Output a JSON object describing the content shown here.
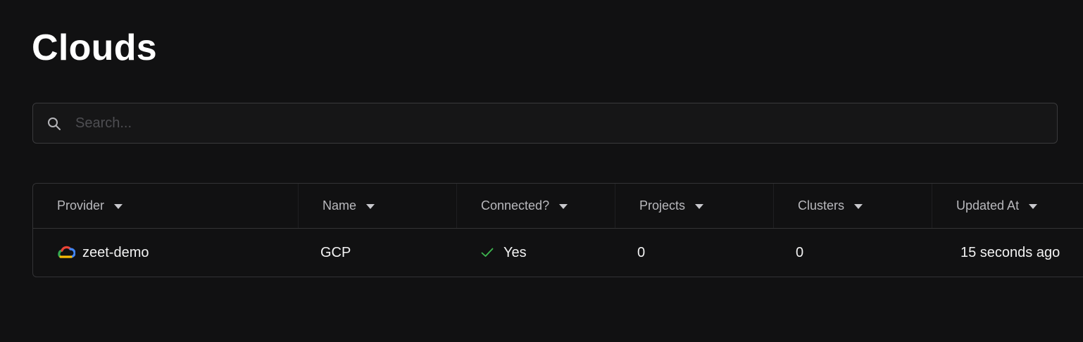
{
  "page": {
    "title": "Clouds"
  },
  "search": {
    "placeholder": "Search...",
    "value": "",
    "icon": "search-icon"
  },
  "table": {
    "columns": [
      {
        "label": "Provider",
        "icon": "caret-down-icon"
      },
      {
        "label": "Name",
        "icon": "caret-down-icon"
      },
      {
        "label": "Connected?",
        "icon": "caret-down-icon"
      },
      {
        "label": "Projects",
        "icon": "caret-down-icon"
      },
      {
        "label": "Clusters",
        "icon": "caret-down-icon"
      },
      {
        "label": "Updated At",
        "icon": "caret-down-icon"
      }
    ],
    "rows": [
      {
        "provider_icon": "google-cloud-icon",
        "provider": "zeet-demo",
        "name": "GCP",
        "connected_icon": "check-icon",
        "connected": "Yes",
        "projects": "0",
        "clusters": "0",
        "updated_at": "15 seconds ago"
      }
    ]
  },
  "colors": {
    "background": "#111112",
    "border": "#333335",
    "check_green": "#3fb950",
    "header_text": "#b9b9bd"
  }
}
